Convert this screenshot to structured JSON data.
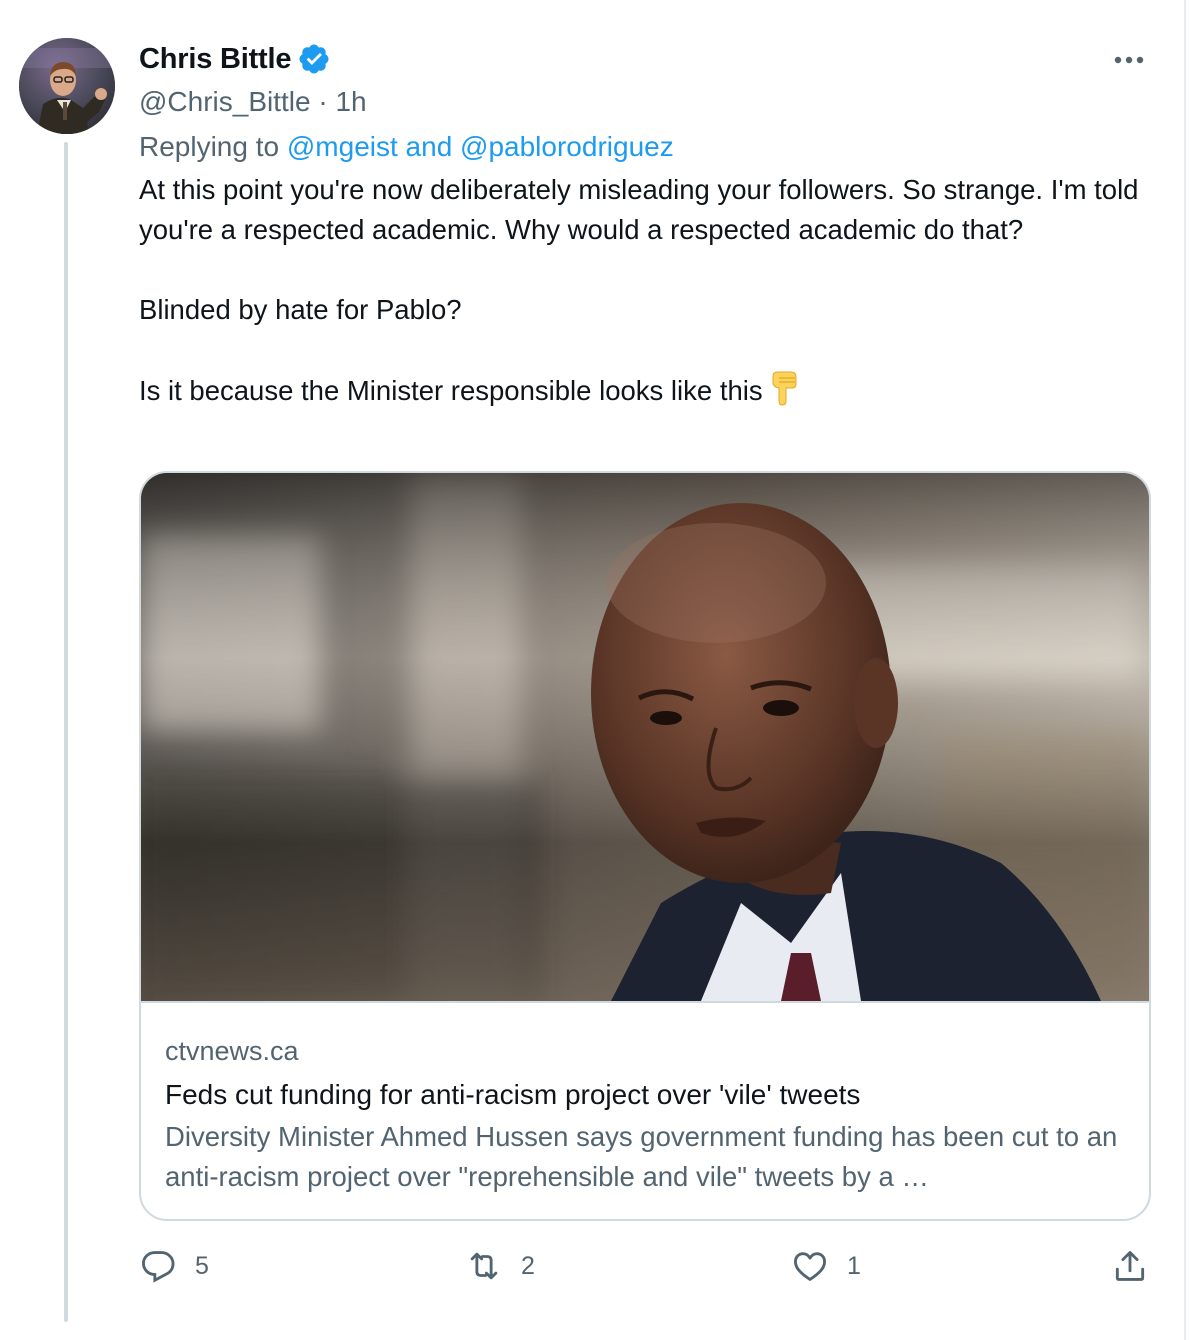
{
  "tweet": {
    "display_name": "Chris Bittle",
    "handle": "@Chris_Bittle",
    "separator": "·",
    "time": "1h",
    "replying_prefix": "Replying to",
    "replying_mentions": "@mgeist and @pablorodriguez",
    "paragraph_1": "At this point you're now deliberately misleading your followers. So strange. I'm told you're a respected academic. Why would a respected academic do that?",
    "paragraph_2": "Blinded by hate for Pablo?",
    "paragraph_3": "Is it because the Minister responsible looks like this",
    "emoji": "backhand-index-pointing-down-icon"
  },
  "card": {
    "domain": "ctvnews.ca",
    "title": "Feds cut funding for anti-racism project over 'vile' tweets",
    "description": "Diversity Minister Ahmed Hussen says government funding has been cut to an anti-racism project over \"reprehensible and vile\" tweets by a …"
  },
  "actions": {
    "reply_count": "5",
    "retweet_count": "2",
    "like_count": "1"
  },
  "icons": {
    "verified": "verified-badge-icon",
    "more": "more-options-icon",
    "reply": "reply-icon",
    "retweet": "retweet-icon",
    "like": "heart-icon",
    "share": "share-icon"
  },
  "colors": {
    "accent": "#1d9bf0",
    "secondary_text": "#536471",
    "primary_text": "#0f1419",
    "border": "#cfd9de"
  }
}
